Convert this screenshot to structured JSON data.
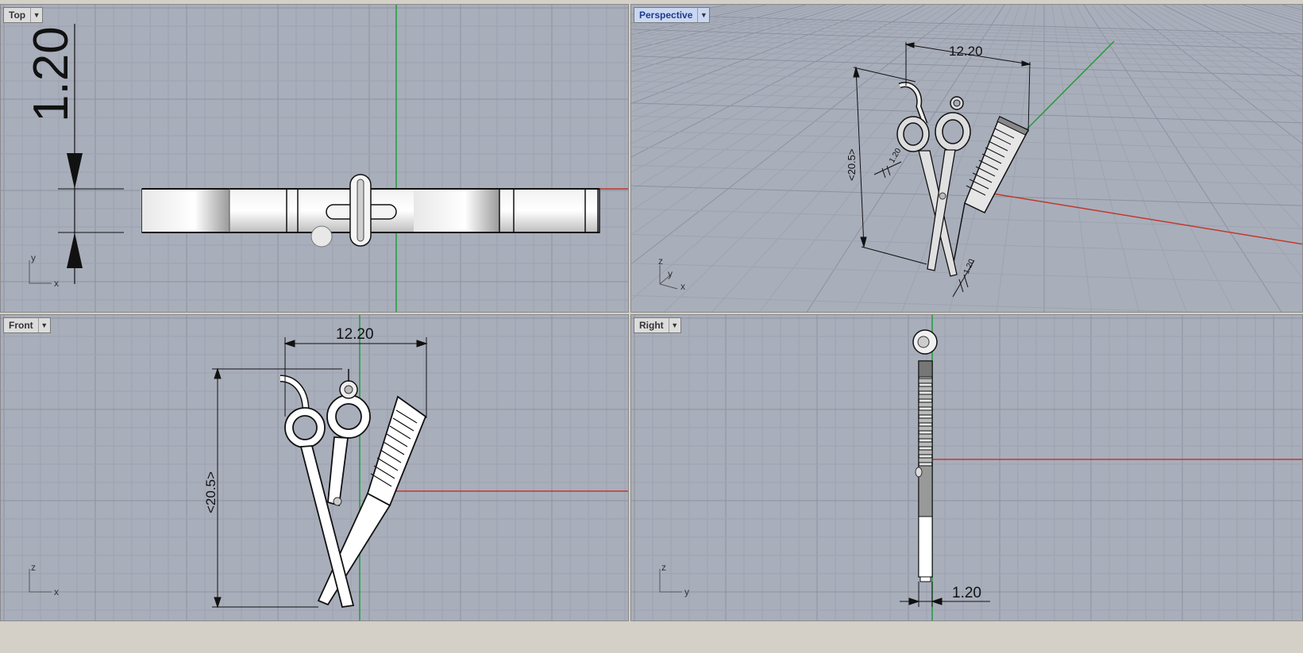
{
  "viewports": {
    "top": {
      "title": "Top",
      "axis_h": "x",
      "axis_v": "y",
      "dim_height": "1.20"
    },
    "perspective": {
      "title": "Perspective",
      "axis_1": "z",
      "axis_2": "y",
      "axis_3": "x",
      "dim_width": "12.20",
      "dim_height": "<20.5>",
      "dim_thickness_a": "1.20",
      "dim_thickness_b": "1.20"
    },
    "front": {
      "title": "Front",
      "axis_h": "x",
      "axis_v": "z",
      "dim_width": "12.20",
      "dim_height": "<20.5>"
    },
    "right": {
      "title": "Right",
      "axis_h": "y",
      "axis_v": "z",
      "dim_thickness": "1.20"
    }
  },
  "colors": {
    "viewport_bg": "#a9aebb",
    "grid_minor": "#9ea3b0",
    "grid_major": "#8d92a0",
    "axis_x": "#c0392b",
    "axis_y": "#1e9e3a",
    "model_fill": "#ffffff",
    "dim_line": "#111111",
    "active_tab": "#c9d7f2"
  },
  "icons": {
    "dropdown": "chevron-down-icon",
    "axis_widget": "axis-triad-icon"
  }
}
